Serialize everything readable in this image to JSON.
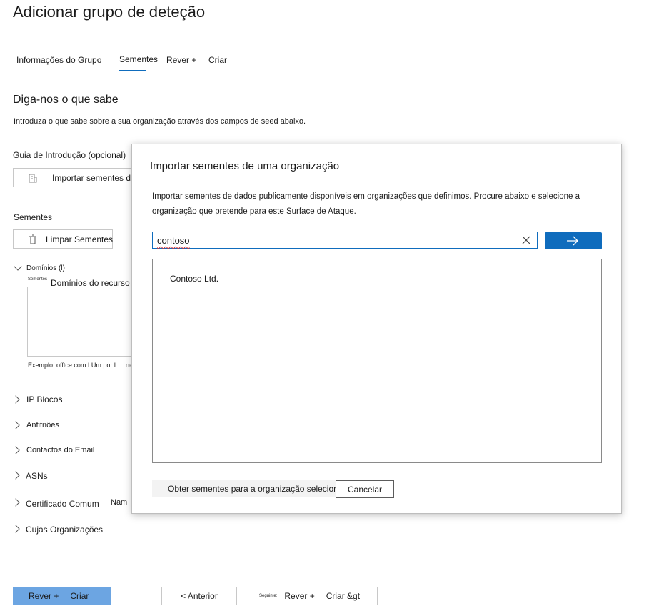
{
  "page": {
    "title": "Adicionar grupo de deteção",
    "tabs": [
      {
        "label": "Informações do Grupo"
      },
      {
        "label": "Sementes"
      },
      {
        "label": "Rever +"
      },
      {
        "label": "Criar"
      }
    ],
    "heading": "Diga-nos o que sabe",
    "intro": "Introduza o que sabe sobre a sua organização através dos campos de seed abaixo.",
    "getting_started_label": "Guia de Introdução (opcional)",
    "import_button_label": "Importar sementes de",
    "seeds_label": "Sementes",
    "clear_seeds_label": "Limpar Sementes",
    "domains": {
      "label": "Domínios (l)",
      "tiny_label": "Sementes",
      "placeholder": "Domínios do recurso",
      "example": "Exemplo: offtce.com I Um por l",
      "example_tail": "ne"
    },
    "sections": [
      {
        "label": "IP Blocos"
      },
      {
        "label": "Anfitriões"
      },
      {
        "label": "Contactos do Email"
      },
      {
        "label": "ASNs"
      },
      {
        "label": "Certificado Comum"
      },
      {
        "label": "Cujas Organizações"
      }
    ],
    "cert_extra": "Nam"
  },
  "modal": {
    "title": "Importar sementes de uma organização",
    "description": "Importar sementes de dados publicamente disponíveis em organizações que definimos. Procure abaixo e selecione a organização que pretende para este Surface de Ataque.",
    "search_value": "contoso",
    "results": [
      "Contoso Ltd."
    ],
    "get_seeds_label": "Obter sementes para a organização selecionada",
    "cancel_label": "Cancelar"
  },
  "footer": {
    "review_create_part1": "Rever +",
    "review_create_part2": "Criar",
    "previous_label": "< Anterior",
    "next_tiny": "Seguinte:",
    "next_part1": "Rever +",
    "next_part2": "Criar &gt"
  },
  "colors": {
    "accent": "#0f6cbd",
    "primary_button": "#6ca5e2",
    "error_underline": "#d13438"
  },
  "icons": [
    "building-icon",
    "trash-icon",
    "chevron-down-icon",
    "chevron-right-icon",
    "close-icon",
    "arrow-right-icon"
  ]
}
